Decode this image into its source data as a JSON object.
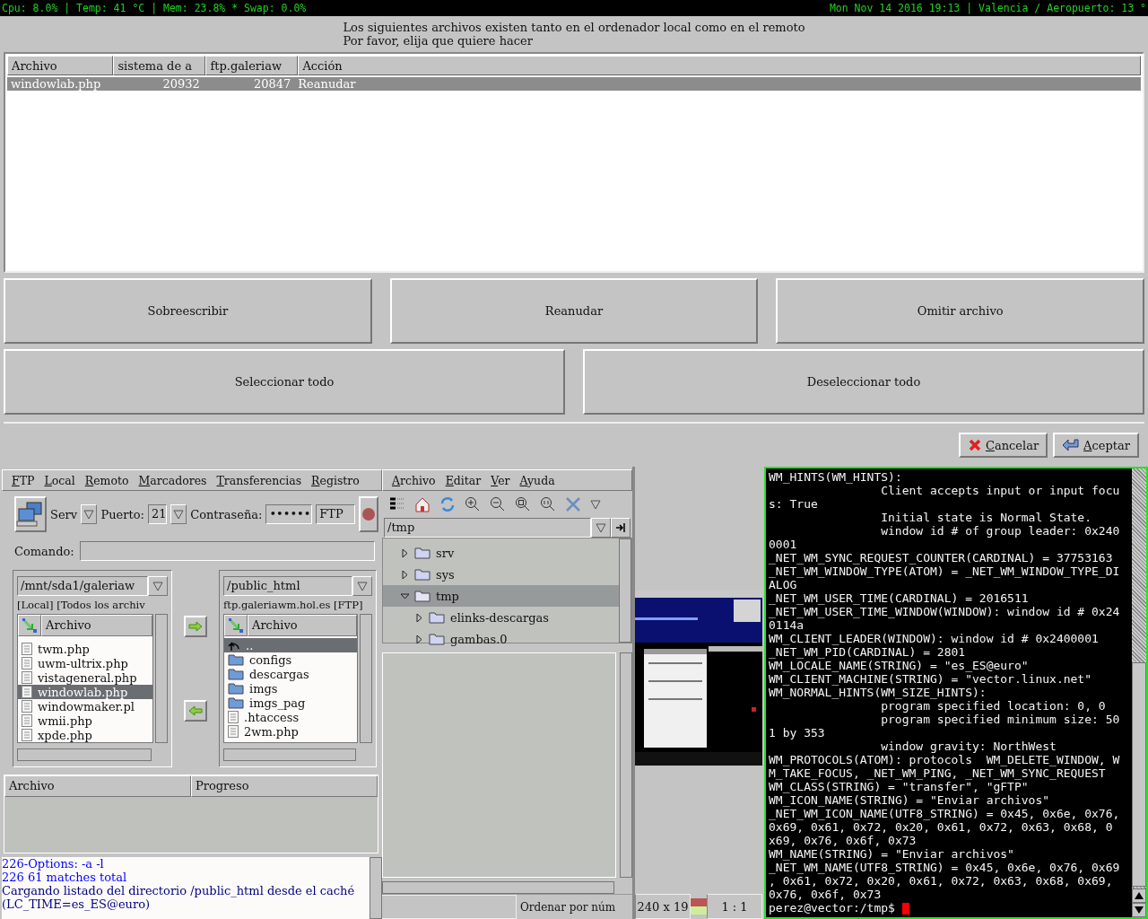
{
  "status_bar": {
    "system": "Cpu: 8.0% | Temp: 41 °C | Mem: 23.8% * Swap: 0.0%",
    "clock": "Mon Nov 14 2016 19:13 | Valencia / Aeropuerto: 13 °"
  },
  "dialog": {
    "message": [
      "Los siguientes archivos existen tanto en el ordenador local como en el remoto",
      "Por favor, elija que quiere hacer"
    ],
    "table": {
      "columns": [
        "Archivo",
        "sistema de a",
        "ftp.galeriaw",
        "Acción"
      ],
      "rows": [
        {
          "cells": [
            "windowlab.php",
            "20932",
            "20847",
            "Reanudar"
          ],
          "selected": true
        }
      ]
    },
    "button_rows": [
      [
        "Sobreescribir",
        "Reanudar",
        "Omitir archivo"
      ],
      [
        "Seleccionar todo",
        "Deseleccionar todo"
      ]
    ],
    "footer_buttons": [
      {
        "label": "Cancelar",
        "kind": "cancel"
      },
      {
        "label": "Aceptar",
        "kind": "ok"
      }
    ]
  },
  "ftp": {
    "menu": [
      "FTP",
      "Local",
      "Remoto",
      "Marcadores",
      "Transferencias",
      "Registro"
    ],
    "toolbar": {
      "host_label": "Serv",
      "port_label": "Puerto:",
      "port": "21",
      "password_label": "Contraseña:",
      "password": "••••••",
      "protocol": "FTP"
    },
    "command_label": "Comando:",
    "local": {
      "path": "/mnt/sda1/galeriaw",
      "info": "[Local] [Todos los archiv",
      "column": "Archivo",
      "files": [
        {
          "name": "twm.php",
          "kind": "file",
          "selected": false
        },
        {
          "name": "uwm-ultrix.php",
          "kind": "file",
          "selected": false
        },
        {
          "name": "vistageneral.php",
          "kind": "file",
          "selected": false
        },
        {
          "name": "windowlab.php",
          "kind": "file",
          "selected": true
        },
        {
          "name": "windowmaker.pl",
          "kind": "file",
          "selected": false
        },
        {
          "name": "wmii.php",
          "kind": "file",
          "selected": false
        },
        {
          "name": "xpde.php",
          "kind": "file",
          "selected": false
        }
      ]
    },
    "remote": {
      "path": "/public_html",
      "info": "ftp.galeriawm.hol.es [FTP]",
      "column": "Archivo",
      "files": [
        {
          "name": "..",
          "kind": "up",
          "selected": true
        },
        {
          "name": "configs",
          "kind": "folder",
          "selected": false
        },
        {
          "name": "descargas",
          "kind": "folder",
          "selected": false
        },
        {
          "name": "imgs",
          "kind": "folder",
          "selected": false
        },
        {
          "name": "imgs_pag",
          "kind": "folder",
          "selected": false
        },
        {
          "name": ".htaccess",
          "kind": "file",
          "selected": false
        },
        {
          "name": "2wm.php",
          "kind": "file",
          "selected": false
        }
      ]
    },
    "transfers": {
      "columns": [
        "Archivo",
        "Progreso"
      ]
    },
    "log": [
      {
        "text": "226-Options: -a -l",
        "color": "#0000ff"
      },
      {
        "text": "226 61 matches total",
        "color": "#0000ff"
      },
      {
        "text": "Cargando listado del directorio /public_html desde el caché",
        "color": "#000080"
      },
      {
        "text": "(LC_TIME=es_ES@euro)",
        "color": "#000080"
      }
    ]
  },
  "viewer": {
    "menu": [
      "Archivo",
      "Editar",
      "Ver",
      "Ayuda"
    ],
    "path": "/tmp",
    "tree": [
      {
        "name": "srv",
        "expanded": false,
        "selected": false
      },
      {
        "name": "sys",
        "expanded": false,
        "selected": false
      },
      {
        "name": "tmp",
        "expanded": true,
        "selected": true,
        "children": [
          {
            "name": "elinks-descargas",
            "expanded": false,
            "selected": false
          },
          {
            "name": "gambas.0",
            "expanded": false,
            "selected": false
          }
        ]
      }
    ],
    "status": [
      "Ordenar por núm",
      "240 x 19",
      "1 : 1"
    ],
    "thumbnail": {
      "kind": "picture"
    }
  },
  "terminal": {
    "lines": [
      {
        "text": "WM_HINTS(WM_HINTS):",
        "indented": false
      },
      {
        "text": "Client accepts input or input focu",
        "indented": true
      },
      {
        "text": "s: True",
        "indented": false
      },
      {
        "text": "Initial state is Normal State.",
        "indented": true
      },
      {
        "text": "window id # of group leader: 0x240",
        "indented": true
      },
      {
        "text": "0001",
        "indented": false
      },
      {
        "text": "_NET_WM_SYNC_REQUEST_COUNTER(CARDINAL) = 37753163",
        "indented": false
      },
      {
        "text": "_NET_WM_WINDOW_TYPE(ATOM) = _NET_WM_WINDOW_TYPE_DI",
        "indented": false
      },
      {
        "text": "ALOG",
        "indented": false
      },
      {
        "text": "_NET_WM_USER_TIME(CARDINAL) = 2016511",
        "indented": false
      },
      {
        "text": "_NET_WM_USER_TIME_WINDOW(WINDOW): window id # 0x24",
        "indented": false
      },
      {
        "text": "0114a",
        "indented": false
      },
      {
        "text": "WM_CLIENT_LEADER(WINDOW): window id # 0x2400001",
        "indented": false
      },
      {
        "text": "_NET_WM_PID(CARDINAL) = 2801",
        "indented": false
      },
      {
        "text": "WM_LOCALE_NAME(STRING) = \"es_ES@euro\"",
        "indented": false
      },
      {
        "text": "WM_CLIENT_MACHINE(STRING) = \"vector.linux.net\"",
        "indented": false
      },
      {
        "text": "WM_NORMAL_HINTS(WM_SIZE_HINTS):",
        "indented": false
      },
      {
        "text": "program specified location: 0, 0",
        "indented": true
      },
      {
        "text": "program specified minimum size: 50",
        "indented": true
      },
      {
        "text": "1 by 353",
        "indented": false
      },
      {
        "text": "window gravity: NorthWest",
        "indented": true
      },
      {
        "text": "WM_PROTOCOLS(ATOM): protocols  WM_DELETE_WINDOW, W",
        "indented": false
      },
      {
        "text": "M_TAKE_FOCUS, _NET_WM_PING, _NET_WM_SYNC_REQUEST",
        "indented": false
      },
      {
        "text": "WM_CLASS(STRING) = \"transfer\", \"gFTP\"",
        "indented": false
      },
      {
        "text": "WM_ICON_NAME(STRING) = \"Enviar archivos\"",
        "indented": false
      },
      {
        "text": "_NET_WM_ICON_NAME(UTF8_STRING) = 0x45, 0x6e, 0x76,",
        "indented": false
      },
      {
        "text": "0x69, 0x61, 0x72, 0x20, 0x61, 0x72, 0x63, 0x68, 0",
        "indented": false
      },
      {
        "text": "x69, 0x76, 0x6f, 0x73",
        "indented": false
      },
      {
        "text": "WM_NAME(STRING) = \"Enviar archivos\"",
        "indented": false
      },
      {
        "text": "_NET_WM_NAME(UTF8_STRING) = 0x45, 0x6e, 0x76, 0x69",
        "indented": false
      },
      {
        "text": ", 0x61, 0x72, 0x20, 0x61, 0x72, 0x63, 0x68, 0x69,",
        "indented": false
      },
      {
        "text": "0x76, 0x6f, 0x73",
        "indented": false
      }
    ],
    "prompt": "perez@vector:/tmp$"
  }
}
